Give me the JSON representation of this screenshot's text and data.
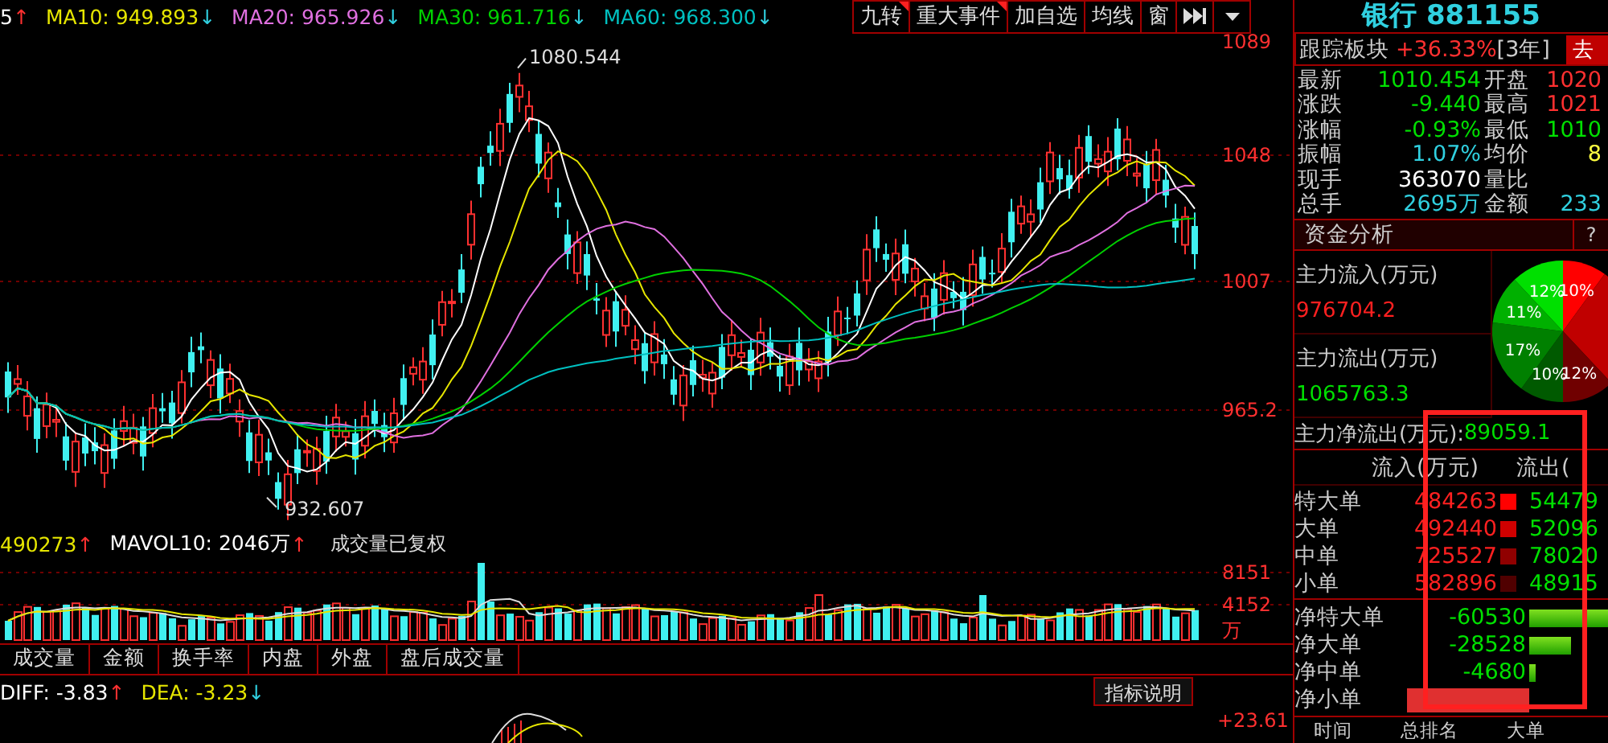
{
  "toolbar": {
    "indicators": [
      {
        "text": "5",
        "color": "#ffffff",
        "arrow": {
          "symbol": "↑",
          "color": "#ff3030"
        }
      },
      {
        "text": "MA10: 949.893",
        "color": "#e6e600",
        "arrow": {
          "symbol": "↓",
          "color": "#30d0e0"
        }
      },
      {
        "text": "MA20: 965.926",
        "color": "#e070e0",
        "arrow": {
          "symbol": "↓",
          "color": "#30d0e0"
        }
      },
      {
        "text": "MA30: 961.716",
        "color": "#00d000",
        "arrow": {
          "symbol": "↓",
          "color": "#30d0e0"
        }
      },
      {
        "text": "MA60: 968.300",
        "color": "#00c0c0",
        "arrow": {
          "symbol": "↓",
          "color": "#30d0e0"
        }
      }
    ],
    "buttons": [
      {
        "label": "九转",
        "flagged": true
      },
      {
        "label": "重大事件",
        "flagged": true
      },
      {
        "label": "加自选",
        "flagged": false
      },
      {
        "label": "均线",
        "flagged": false
      },
      {
        "label": "窗",
        "flagged": false
      }
    ]
  },
  "price_chart": {
    "price_labels": [
      "1089",
      "1048",
      "1007",
      "965.2"
    ],
    "high_label": "1080.544",
    "low_label": "932.607"
  },
  "volume": {
    "indicators": [
      {
        "text": "490273",
        "color": "#e6e600",
        "arrow": {
          "symbol": "↑",
          "color": "#ff3030"
        }
      },
      {
        "text": "MAVOL10: 2046万",
        "color": "#ffffff",
        "arrow": {
          "symbol": "↑",
          "color": "#ff3030"
        }
      }
    ],
    "note": "成交量已复权",
    "axis_labels": [
      "8151",
      "4152",
      "万"
    ]
  },
  "indicator_tabs": [
    "成交量",
    "金额",
    "换手率",
    "内盘",
    "外盘",
    "盘后成交量"
  ],
  "macd": {
    "indicators": [
      {
        "text": "DIFF: -3.83",
        "color": "#ffffff",
        "arrow": {
          "symbol": "↑",
          "color": "#ff3030"
        }
      },
      {
        "text": "DEA: -3.23",
        "color": "#e6e600",
        "arrow": {
          "symbol": "↓",
          "color": "#30d0e0"
        }
      }
    ],
    "help_button": "指标说明",
    "axis_label": "+23.61"
  },
  "quote": {
    "title": "银行 881155",
    "tracking": {
      "label": "跟踪板块",
      "change": "+36.33%",
      "period": "[3年]",
      "button": "去"
    },
    "rows": [
      {
        "label": "最新",
        "value": {
          "text": "1010.454",
          "color": "#00e000"
        },
        "label2": "开盘",
        "value2": {
          "text": "1020",
          "color": "#ff3030"
        }
      },
      {
        "label": "涨跌",
        "value": {
          "text": "-9.440",
          "color": "#00e000"
        },
        "label2": "最高",
        "value2": {
          "text": "1021",
          "color": "#ff3030"
        }
      },
      {
        "label": "涨幅",
        "value": {
          "text": "-0.93%",
          "color": "#00e000"
        },
        "label2": "最低",
        "value2": {
          "text": "1010",
          "color": "#00e000"
        }
      },
      {
        "label": "振幅",
        "value": {
          "text": "1.07%",
          "color": "#30d0e0"
        },
        "label2": "均价",
        "value2": {
          "text": "8",
          "color": "#ffff40"
        }
      },
      {
        "label": "现手",
        "value": {
          "text": "363070",
          "color": "#ffffff"
        },
        "label2": "量比"
      },
      {
        "label": "总手",
        "value": {
          "text": "2695万",
          "color": "#30d0e0"
        },
        "label2": "金额",
        "value2": {
          "text": "233",
          "color": "#30d0e0"
        }
      }
    ]
  },
  "fund_analysis": {
    "title": "资金分析",
    "help": "?",
    "inflow": {
      "label": "主力流入(万元)",
      "value": "976704.2"
    },
    "outflow": {
      "label": "主力流出(万元)",
      "value": "1065763.3"
    },
    "pie_slices": [
      {
        "label": "10%",
        "color": "#ff0000"
      },
      {
        "color": "#c00000"
      },
      {
        "label": "12%",
        "color": "#700000"
      },
      {
        "label": "10%",
        "color": "#005a00"
      },
      {
        "label": "17%",
        "color": "#008000"
      },
      {
        "label": "11%",
        "color": "#00b000"
      },
      {
        "label": "12%",
        "color": "#00e000"
      }
    ],
    "net": {
      "label": "主力净流出(万元):",
      "value": "89059.1"
    },
    "columns": [
      "流入(万元)",
      "流出("
    ],
    "rows": [
      {
        "label": "特大单",
        "inflow": "484263",
        "outflow": "54479",
        "color": "#ff0000"
      },
      {
        "label": "大单",
        "inflow": "492440",
        "outflow": "52096",
        "color": "#d00000"
      },
      {
        "label": "中单",
        "inflow": "725527",
        "outflow": "78020",
        "color": "#900000"
      },
      {
        "label": "小单",
        "inflow": "582896",
        "outflow": "48915",
        "color": "#500000"
      }
    ],
    "net_rows": [
      {
        "kind": "outflow",
        "label": "净特大单",
        "value": "-60530"
      },
      {
        "kind": "outflow",
        "label": "净大单",
        "value": "-28528"
      },
      {
        "kind": "outflow",
        "label": "净中单",
        "value": "-4680"
      },
      {
        "kind": "inflow",
        "label": "净小单"
      }
    ],
    "bottom_columns": [
      "时间",
      "总排名",
      "大单"
    ]
  }
}
